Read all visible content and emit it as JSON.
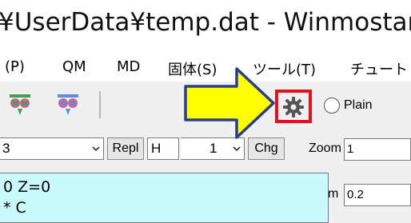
{
  "window": {
    "title": "¥UserData¥temp.dat - Winmostar("
  },
  "menu": {
    "items": [
      "(P)",
      "QM",
      "MD",
      "固体(S)",
      "ツール(T)",
      "チュート"
    ]
  },
  "toolbar": {
    "icons": [
      "molecule-view-icon-1",
      "molecule-view-icon-2"
    ],
    "settings_icon": "gear-icon",
    "radio_label": "Plain"
  },
  "controls": {
    "combo1_value": "3",
    "repl_label": "Repl",
    "element_value": "H",
    "number_value": "1",
    "chg_label": "Chg",
    "zoom_label": "Zoom",
    "zoom_value": "1",
    "atom_label": "Atom",
    "atom_value": "0.2"
  },
  "editor": {
    "lines": [
      "0  Z=0",
      "* C"
    ]
  },
  "colors": {
    "highlight_border": "#e0141e",
    "arrow_fill": "#ffff00",
    "editor_bg": "#c9fbfc"
  }
}
